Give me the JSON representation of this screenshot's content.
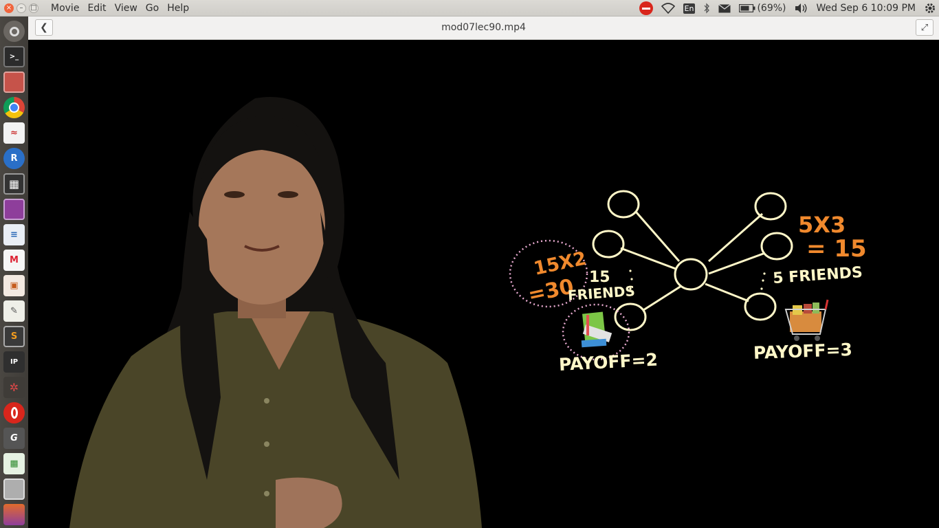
{
  "menubar": {
    "items": [
      "Movie",
      "Edit",
      "View",
      "Go",
      "Help"
    ],
    "keyboard_layout": "En",
    "battery": "(69%)",
    "clock": "Wed Sep  6 10:09 PM"
  },
  "window": {
    "title": "mod07lec90.mp4"
  },
  "launcher": {
    "icons": [
      "ubuntu-dash-icon",
      "terminal-icon",
      "archive-icon",
      "chrome-icon",
      "pdf-viewer-icon",
      "r-icon",
      "video-editor-icon",
      "media-icon",
      "writer-doc-icon",
      "gmail-icon",
      "impress-icon",
      "text-editor-icon",
      "sublime-text-icon",
      "ipython-icon",
      "network-icon",
      "opera-icon",
      "geogebra-icon",
      "spreadsheet-icon",
      "storage-icon",
      "app-icon"
    ]
  },
  "video": {
    "annotations": {
      "left_calc_1": "15X2",
      "left_calc_2": "=30",
      "left_count": "15",
      "left_label": "FRIENDS",
      "left_payoff": "PAYOFF=2",
      "right_calc_1": "5X3",
      "right_calc_2": "= 15",
      "right_label": "5 FRIENDS",
      "right_payoff": "PAYOFF=3"
    },
    "colors": {
      "chalk_white": "#fff7c8",
      "chalk_orange": "#f0892d",
      "dotted_pink": "#e7a9cf"
    }
  }
}
